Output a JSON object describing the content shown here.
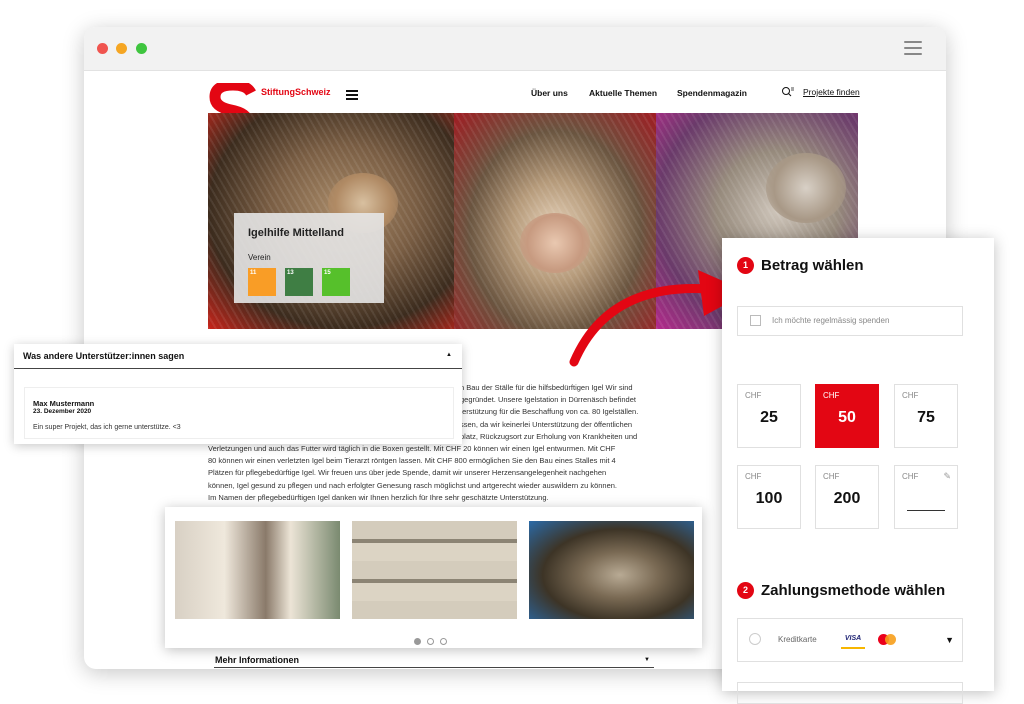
{
  "site": {
    "brand": "StiftungSchweiz",
    "nav": [
      "Über uns",
      "Aktuelle Themen",
      "Spendenmagazin"
    ],
    "find_projects": "Projekte finden"
  },
  "org": {
    "name": "Igelhilfe Mittelland",
    "type": "Verein",
    "sdgs": [
      {
        "num": "11",
        "color": "#f99d26"
      },
      {
        "num": "13",
        "color": "#3f7e44"
      },
      {
        "num": "15",
        "color": "#56c02b"
      }
    ]
  },
  "testimonials": {
    "title": "Was andere Unterstützer:innen sagen",
    "items": [
      {
        "name": "Max Mustermann",
        "date": "23. Dezember 2020",
        "text": "Ein super Projekt, das ich gerne unterstütze. <3"
      }
    ]
  },
  "body_lines": [
    "n Bau der Ställe für die hilfsbedürftigen Igel Wir sind",
    "gegründet. Unsere Igelstation in Dürrenäsch befindet",
    "terstützung für die Beschaffung von ca. 80 Igelställen.",
    "ssen, da wir keinerlei Unterstützung der öffentlichen",
    "platz, Rückzugsort zur Erholung von Krankheiten und",
    "Verletzungen und auch das Futter wird täglich in die Boxen gestellt. Mit CHF 20 können wir einen Igel entwurmen. Mit CHF",
    "80 können wir einen verletzten Igel beim Tierarzt röntgen lassen. Mit CHF 800 ermöglichen Sie den Bau eines Stalles mit 4",
    "Plätzen für pflegebedürftige Igel. Wir freuen uns über jede Spende, damit wir unserer Herzensangelegenheit nachgehen",
    "können, Igel gesund zu pflegen und nach erfolgter Genesung rasch möglichst und artgerecht wieder auswildern zu können.",
    "Im Namen der pflegebedürftigen Igel danken wir Ihnen herzlich für Ihre sehr geschätzte Unterstützung."
  ],
  "more_info": "Mehr Informationen",
  "gallery": {
    "slides": 3,
    "active": 0
  },
  "donation": {
    "step1_num": "1",
    "step1_title": "Betrag wählen",
    "recurring_label": "Ich möchte regelmässig spenden",
    "currency": "CHF",
    "amounts": [
      "25",
      "50",
      "75",
      "100",
      "200"
    ],
    "selected_amount": "50",
    "custom_amount": "",
    "step2_num": "2",
    "step2_title": "Zahlungsmethode wählen",
    "payment_method": "Kreditkarte",
    "visa": "VISA"
  },
  "colors": {
    "accent": "#e30613",
    "text": "#111111",
    "muted": "#888888"
  }
}
